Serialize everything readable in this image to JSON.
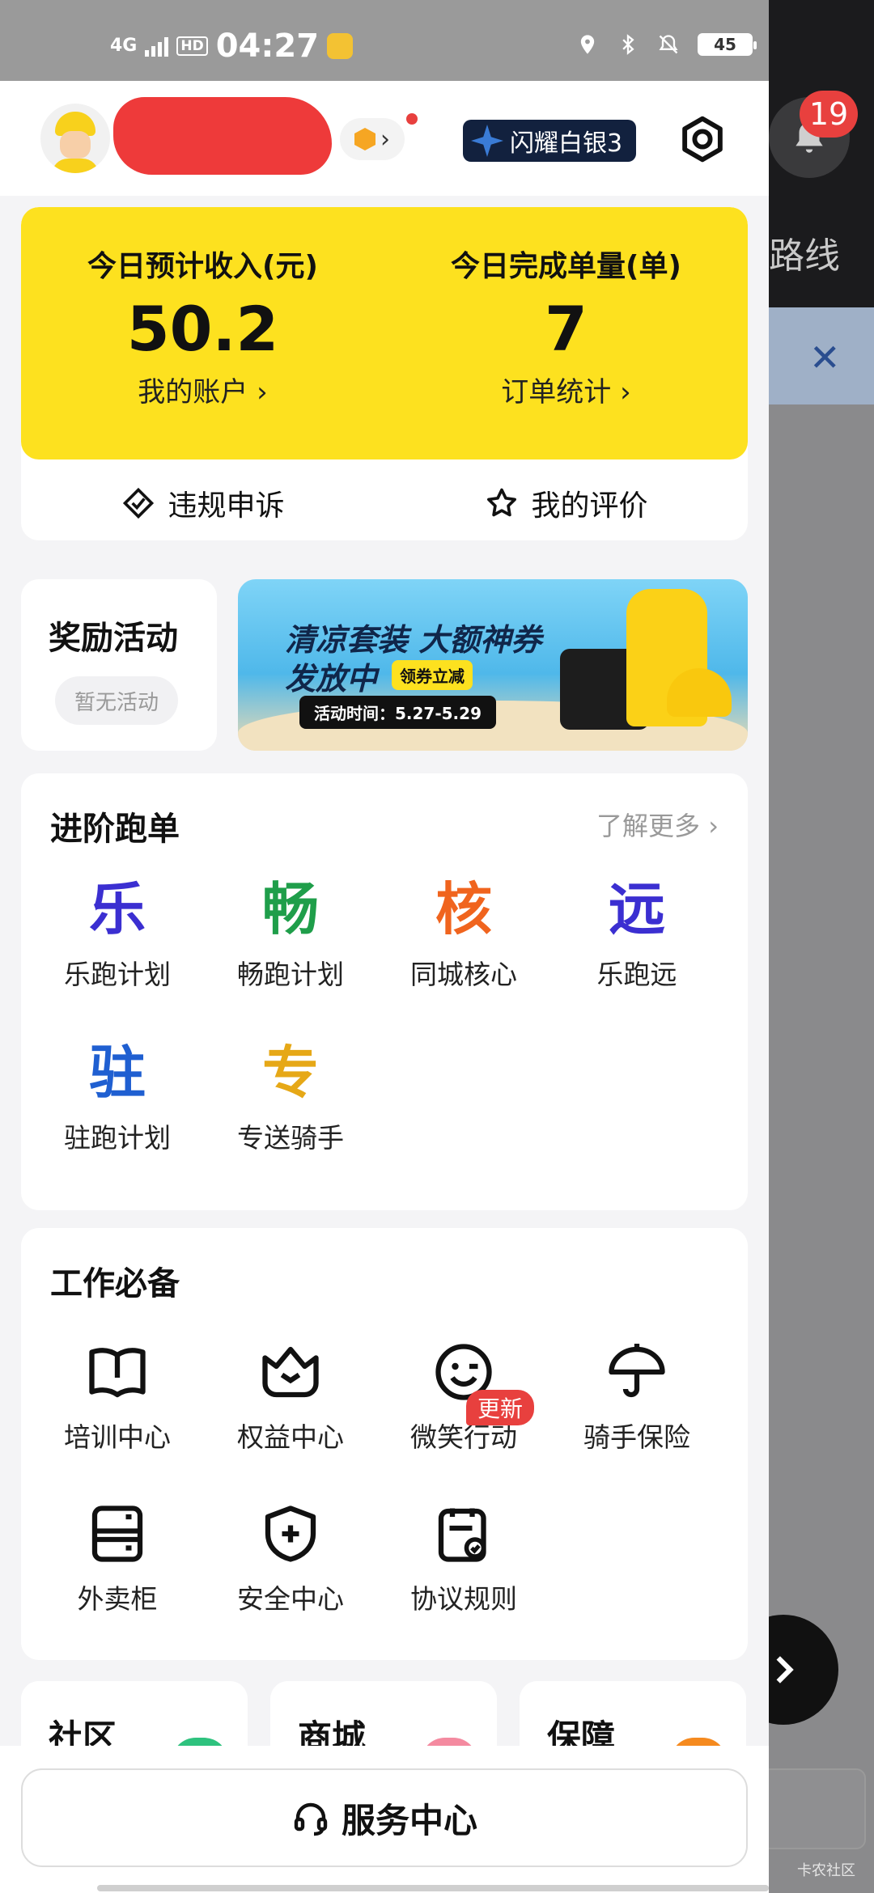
{
  "status_bar": {
    "network": "4G",
    "hd": "HD",
    "time": "04:27",
    "battery": "45"
  },
  "background_app": {
    "notification_count": "19",
    "route_text": "路线"
  },
  "header": {
    "rank_label": "闪耀白银3"
  },
  "stats": {
    "income_label": "今日预计收入(元)",
    "income_value": "50.2",
    "account_link": "我的账户 ›",
    "orders_label": "今日完成单量(单)",
    "orders_value": "7",
    "orders_link": "订单统计 ›",
    "appeal_label": "违规申诉",
    "rating_label": "我的评价"
  },
  "rewards": {
    "title": "奖励活动",
    "empty": "暂无活动"
  },
  "banner": {
    "line1": "清凉套装 大额神券",
    "line2": "发放中",
    "tag": "领券立减",
    "date": "活动时间：5.27-5.29"
  },
  "advanced": {
    "title": "进阶跑单",
    "more": "了解更多 ›",
    "items": [
      {
        "glyph": "乐",
        "label": "乐跑计划",
        "color": "#3b2fd1"
      },
      {
        "glyph": "畅",
        "label": "畅跑计划",
        "color": "#1f9e4a"
      },
      {
        "glyph": "核",
        "label": "同城核心",
        "color": "#f0641e"
      },
      {
        "glyph": "远",
        "label": "乐跑远",
        "color": "#3b2fd1"
      },
      {
        "glyph": "驻",
        "label": "驻跑计划",
        "color": "#1f5fd1"
      },
      {
        "glyph": "专",
        "label": "专送骑手",
        "color": "#e6a817"
      }
    ]
  },
  "work": {
    "title": "工作必备",
    "items": [
      {
        "icon": "book-icon",
        "label": "培训中心"
      },
      {
        "icon": "crown-icon",
        "label": "权益中心"
      },
      {
        "icon": "smile-icon",
        "label": "微笑行动"
      },
      {
        "icon": "umbrella-icon",
        "label": "骑手保险"
      },
      {
        "icon": "locker-icon",
        "label": "外卖柜"
      },
      {
        "icon": "shield-icon",
        "label": "安全中心"
      },
      {
        "icon": "document-icon",
        "label": "协议规则"
      }
    ],
    "new_badge": "更新"
  },
  "tiles": [
    {
      "label": "社区",
      "color": "#2ec27e"
    },
    {
      "label": "商城",
      "color": "#f48aa0"
    },
    {
      "label": "保障",
      "color": "#f58a1f"
    }
  ],
  "service": {
    "label": "服务中心"
  },
  "watermark": "卡农社区"
}
